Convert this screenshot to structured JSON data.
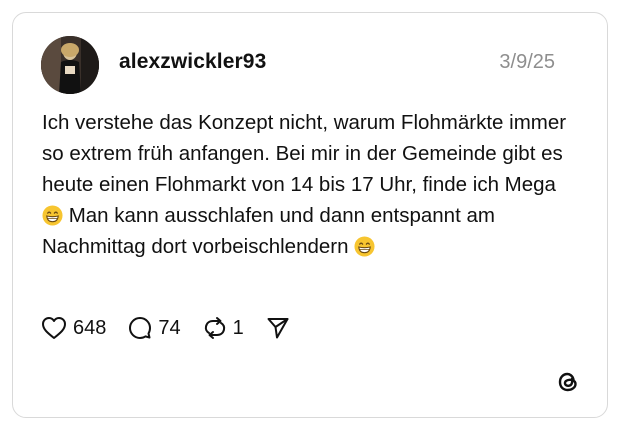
{
  "post": {
    "username": "alexzwickler93",
    "date": "3/9/25",
    "text_parts": [
      "Ich verstehe das Konzept nicht, warum Flohmärkte immer so extrem früh anfangen. Bei mir in der Gemeinde gibt es heute einen Flohmarkt von 14 bis 17 Uhr, finde ich Mega",
      "Man kann ausschlafen und dann entspannt am Nachmittag dort vorbeischlendern"
    ],
    "emoji": "grinning-face-with-smiling-eyes"
  },
  "actions": {
    "likes": "648",
    "replies": "74",
    "reposts": "1",
    "icons": [
      "heart-icon",
      "comment-icon",
      "repost-icon",
      "share-icon"
    ]
  },
  "brand": {
    "logo": "threads-logo",
    "text_color": "#111111",
    "muted_color": "#8e8e8e",
    "border_color": "#d9d9d9"
  }
}
